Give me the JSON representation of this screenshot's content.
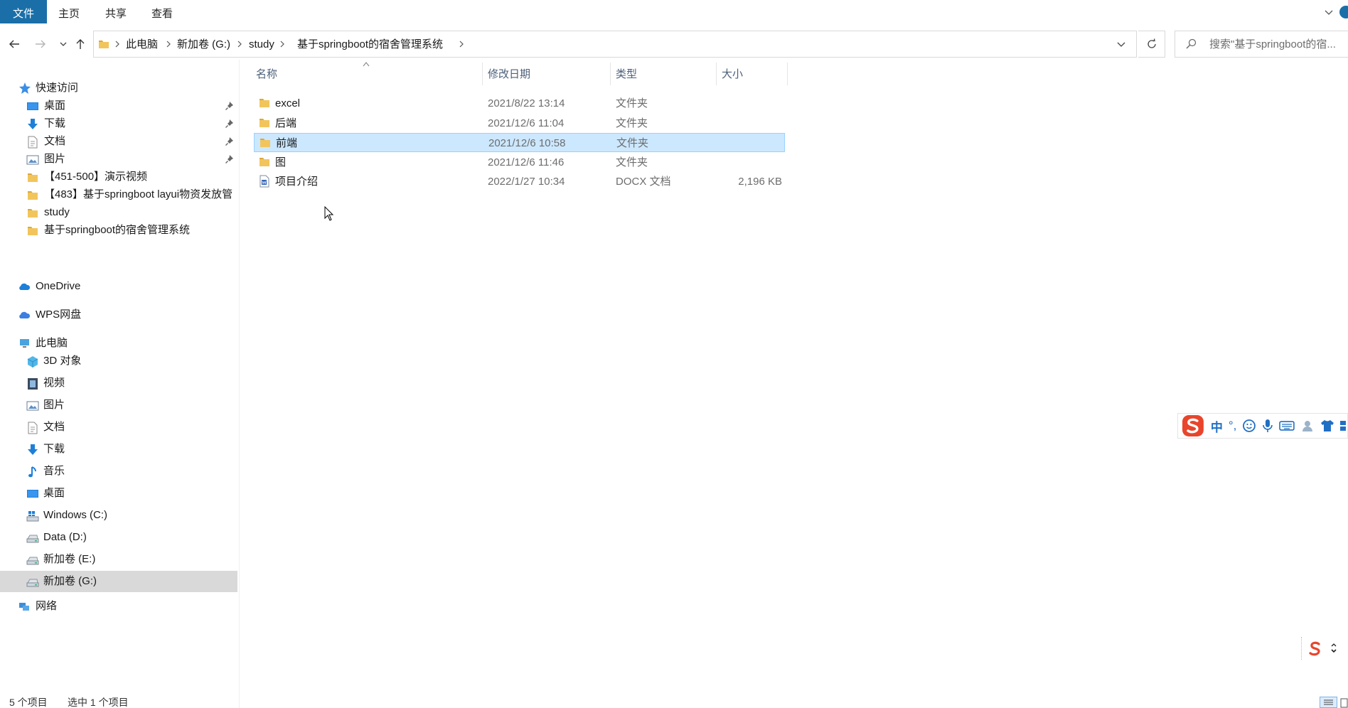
{
  "ribbon": {
    "tabs": [
      "文件",
      "主页",
      "共享",
      "查看"
    ]
  },
  "address": {
    "segments": [
      "此电脑",
      "新加卷 (G:)",
      "study",
      "基于springboot的宿舍管理系统"
    ]
  },
  "search": {
    "placeholder": "搜索\"基于springboot的宿..."
  },
  "sidebar": {
    "quick_access": "快速访问",
    "quick_items": [
      {
        "label": "桌面",
        "icon": "desktop-icon",
        "pinned": true
      },
      {
        "label": "下载",
        "icon": "download-icon",
        "pinned": true
      },
      {
        "label": "文档",
        "icon": "document-icon",
        "pinned": true
      },
      {
        "label": "图片",
        "icon": "picture-icon",
        "pinned": true
      },
      {
        "label": "【451-500】演示视频",
        "icon": "folder-icon",
        "pinned": false
      },
      {
        "label": "【483】基于springboot layui物资发放管",
        "icon": "folder-icon",
        "pinned": false
      },
      {
        "label": "study",
        "icon": "folder-icon",
        "pinned": false
      },
      {
        "label": "基于springboot的宿舍管理系统",
        "icon": "folder-icon",
        "pinned": false
      }
    ],
    "onedrive": "OneDrive",
    "wps": "WPS网盘",
    "this_pc": "此电脑",
    "pc_items": [
      {
        "label": "3D 对象",
        "icon": "3d-objects-icon"
      },
      {
        "label": "视频",
        "icon": "video-icon"
      },
      {
        "label": "图片",
        "icon": "picture-icon"
      },
      {
        "label": "文档",
        "icon": "document-icon"
      },
      {
        "label": "下载",
        "icon": "download-icon"
      },
      {
        "label": "音乐",
        "icon": "music-icon"
      },
      {
        "label": "桌面",
        "icon": "desktop-icon"
      },
      {
        "label": "Windows (C:)",
        "icon": "windows-drive-icon"
      },
      {
        "label": "Data (D:)",
        "icon": "drive-icon"
      },
      {
        "label": "新加卷 (E:)",
        "icon": "drive-icon"
      },
      {
        "label": "新加卷 (G:)",
        "icon": "drive-icon",
        "selected": true
      }
    ],
    "network": "网络"
  },
  "columns": {
    "name": "名称",
    "date": "修改日期",
    "type": "类型",
    "size": "大小"
  },
  "files": [
    {
      "name": "excel",
      "date": "2021/8/22 13:14",
      "type": "文件夹",
      "size": "",
      "icon": "folder-icon"
    },
    {
      "name": "后端",
      "date": "2021/12/6 11:04",
      "type": "文件夹",
      "size": "",
      "icon": "folder-icon"
    },
    {
      "name": "前端",
      "date": "2021/12/6 10:58",
      "type": "文件夹",
      "size": "",
      "icon": "folder-icon",
      "selected": true
    },
    {
      "name": "图",
      "date": "2021/12/6 11:46",
      "type": "文件夹",
      "size": "",
      "icon": "folder-icon"
    },
    {
      "name": "项目介绍",
      "date": "2022/1/27 10:34",
      "type": "DOCX 文档",
      "size": "2,196 KB",
      "icon": "docx-icon"
    }
  ],
  "status": {
    "count": "5 个项目",
    "selected": "选中 1 个项目"
  },
  "ime": {
    "mode": "中",
    "punct": "°,"
  },
  "colors": {
    "accent": "#1a6fa8",
    "selection_bg": "#cce8ff",
    "selection_border": "#99d1ff",
    "folder": "#f2c55c",
    "ime_red": "#e8452c"
  }
}
